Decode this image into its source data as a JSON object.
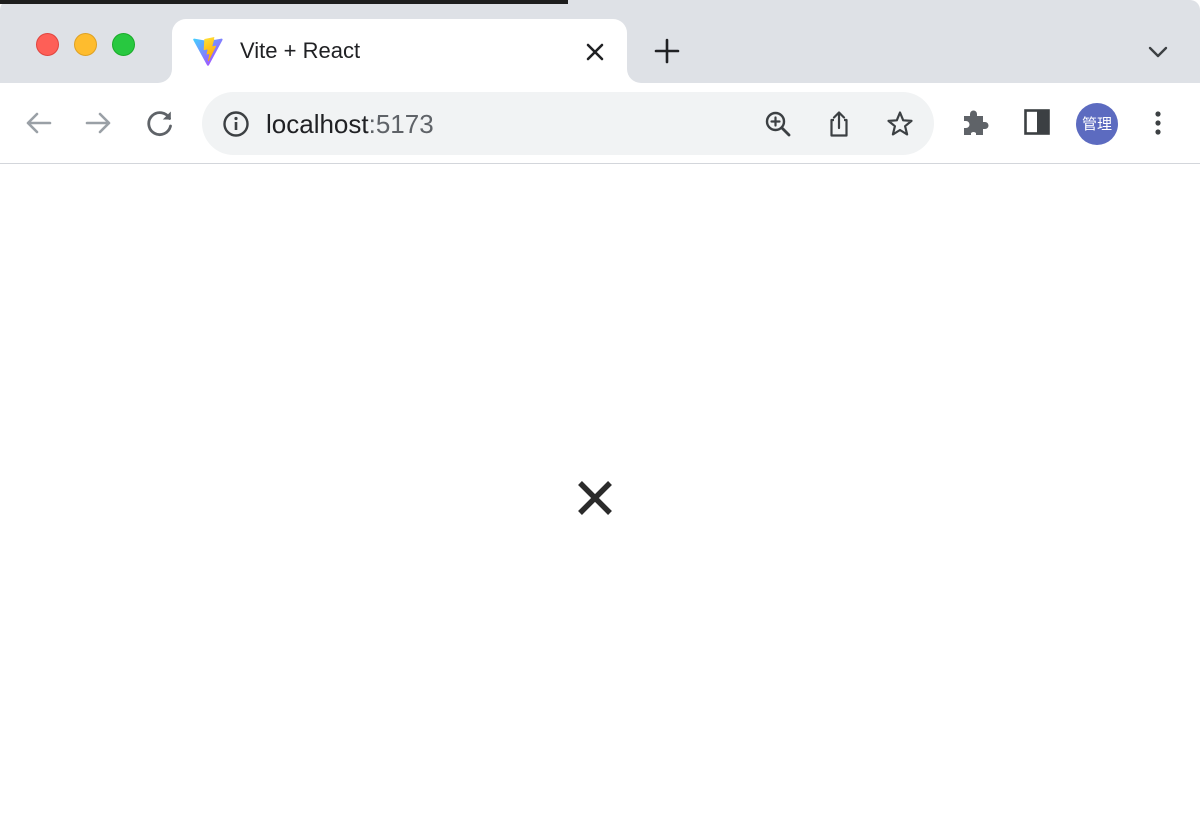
{
  "window": {
    "controls": [
      "close",
      "minimize",
      "maximize"
    ]
  },
  "tab": {
    "title": "Vite + React",
    "favicon": "vite-logo-icon",
    "close_icon": "close-icon"
  },
  "tabstrip": {
    "new_tab_icon": "plus-icon",
    "tab_search_icon": "chevron-down-icon"
  },
  "toolbar": {
    "back_icon": "arrow-left-icon",
    "forward_icon": "arrow-right-icon",
    "reload_icon": "reload-icon"
  },
  "omnibox": {
    "site_info_icon": "info-icon",
    "url_host": "localhost",
    "url_port": ":5173",
    "actions": [
      "zoom-in-icon",
      "share-icon",
      "star-icon"
    ]
  },
  "extensions": {
    "puzzle_icon": "puzzle-icon",
    "side_panel_icon": "side-panel-icon"
  },
  "profile": {
    "avatar_label": "管理",
    "avatar_color": "#5c6bc0"
  },
  "menu": {
    "icon": "more-vert-icon"
  },
  "page": {
    "content_icon": "close-icon"
  },
  "colors": {
    "tabstrip_bg": "#dee1e6",
    "omnibox_bg": "#f1f3f4",
    "traffic_red": "#fe5f57",
    "traffic_yellow": "#febc2e",
    "traffic_green": "#28c840",
    "icon_gray": "#5f6368",
    "icon_disabled": "#9aa0a6"
  }
}
